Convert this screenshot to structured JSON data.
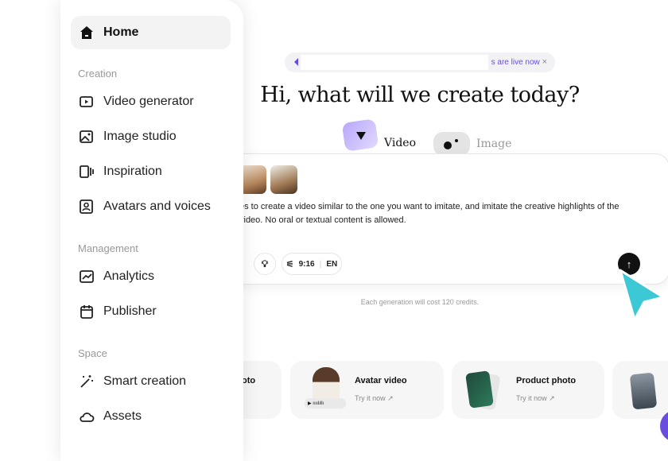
{
  "sidebar": {
    "home": "Home",
    "sections": [
      {
        "label": "Creation",
        "items": [
          "Video generator",
          "Image studio",
          "Inspiration",
          "Avatars and voices"
        ]
      },
      {
        "label": "Management",
        "items": [
          "Analytics",
          "Publisher"
        ]
      },
      {
        "label": "Space",
        "items": [
          "Smart creation",
          "Assets"
        ]
      }
    ]
  },
  "banner": {
    "text": "s are live now",
    "close": "×"
  },
  "heading": "Hi, what will we create today?",
  "tabs": [
    {
      "label": "Video"
    },
    {
      "label": "Image"
    }
  ],
  "prompt": {
    "text": "es to create a video similar to the one you want to imitate, and imitate the creative highlights of the\nvideo. No oral or textual content is allowed.",
    "ratio": "9:16",
    "language": "EN",
    "send": "↑"
  },
  "credits": "Each generation will cost 120 credits.",
  "tiles": [
    {
      "title": "oto"
    },
    {
      "title": "Avatar video",
      "sub": "Try it now ↗"
    },
    {
      "title": "Product photo",
      "sub": "Try it now ↗"
    }
  ],
  "colors": {
    "accent": "#6a4de0",
    "cursor": "#3cc8d4"
  }
}
